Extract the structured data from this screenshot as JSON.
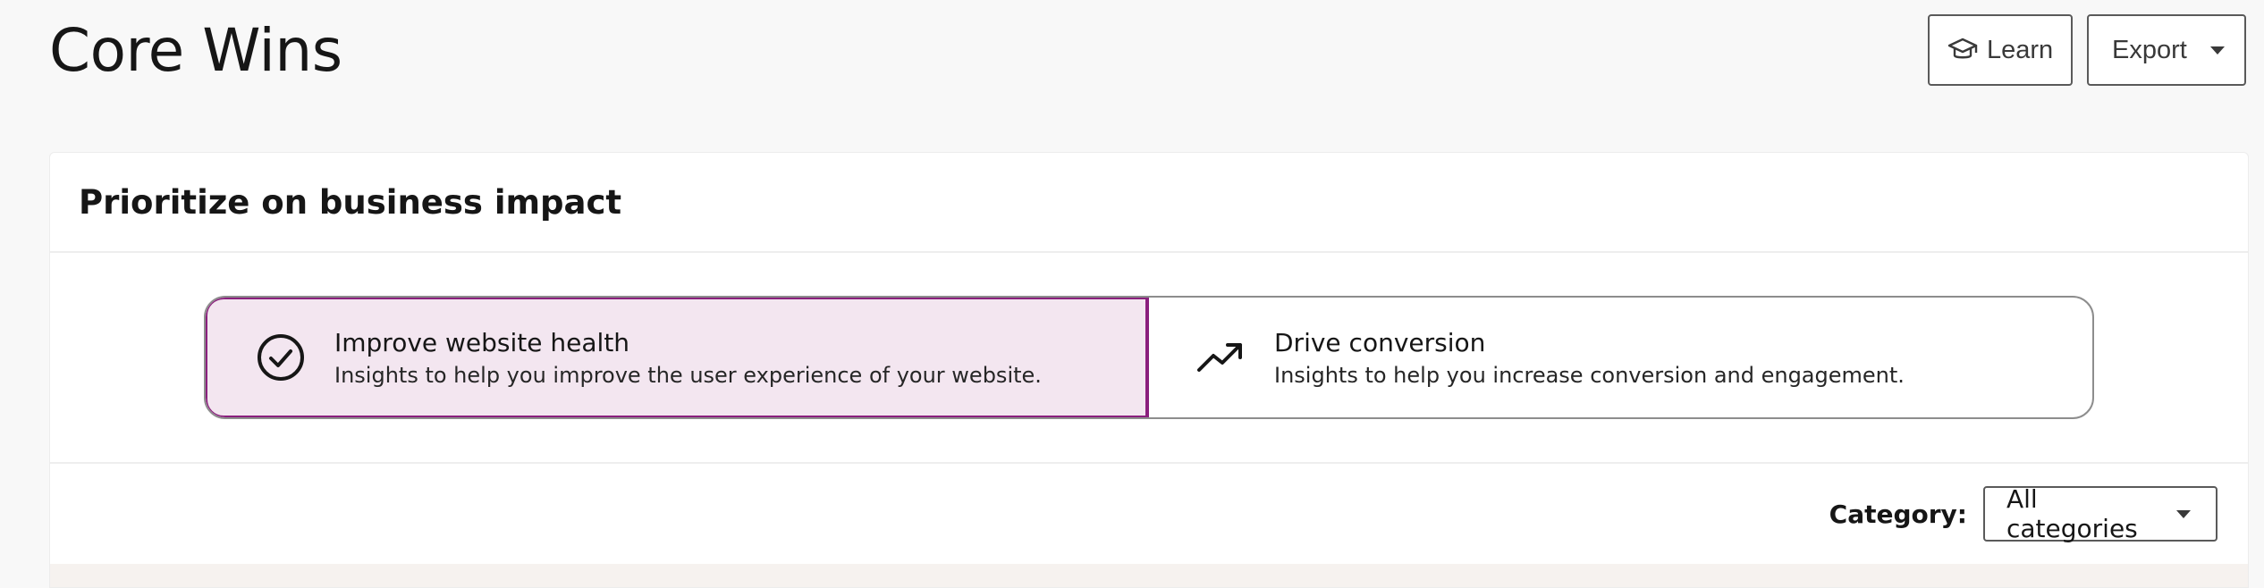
{
  "page": {
    "title": "Core Wins"
  },
  "header": {
    "learn_label": "Learn",
    "learn_icon": "graduation-cap-icon",
    "export_label": "Export",
    "export_icon": "caret-down-icon"
  },
  "card": {
    "title": "Prioritize on business impact",
    "goals": [
      {
        "title": "Improve website health",
        "description": "Insights to help you improve the user experience of your website.",
        "icon": "check-circle-icon",
        "selected": true
      },
      {
        "title": "Drive conversion",
        "description": "Insights to help you increase conversion and engagement.",
        "icon": "trending-up-icon",
        "selected": false
      }
    ],
    "filter": {
      "label": "Category:",
      "selected": "All categories"
    }
  },
  "colors": {
    "accent": "#8a1f7d",
    "selected_bg": "#f3e6f0",
    "border": "#8d8d8d",
    "page_bg": "#f8f8f8"
  }
}
